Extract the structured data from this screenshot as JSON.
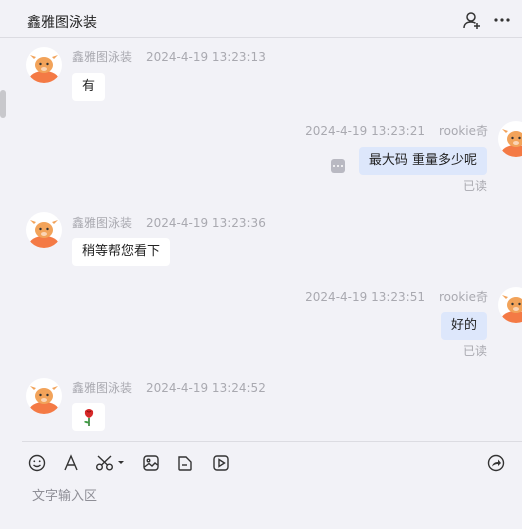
{
  "header": {
    "title": "鑫雅图泳装",
    "icons": [
      "add-contact-icon",
      "more-icon"
    ]
  },
  "messages": [
    {
      "side": "in",
      "sender": "鑫雅图泳装",
      "time": "2024-4-19 13:23:13",
      "text": "有"
    },
    {
      "side": "out",
      "sender": "rookie奇",
      "time": "2024-4-19 13:23:21",
      "text": "最大码  重量多少呢",
      "status": "已读"
    },
    {
      "side": "in",
      "sender": "鑫雅图泳装",
      "time": "2024-4-19 13:23:36",
      "text": "稍等帮您看下"
    },
    {
      "side": "out",
      "sender": "rookie奇",
      "time": "2024-4-19 13:23:51",
      "text": "好的",
      "status": "已读"
    },
    {
      "side": "in",
      "sender": "鑫雅图泳装",
      "time": "2024-4-19 13:24:52",
      "text": "",
      "emoji": "rose"
    }
  ],
  "toolbar": {
    "icons": [
      "emoji-icon",
      "font-icon",
      "screenshot-icon",
      "image-icon",
      "file-icon",
      "video-icon",
      "share-icon"
    ],
    "input_placeholder": "文字输入区"
  },
  "colors": {
    "background": "#f2f2f7",
    "out_bubble": "#dde7fb",
    "in_bubble": "#ffffff",
    "avatar_orange": "#f47a45"
  }
}
